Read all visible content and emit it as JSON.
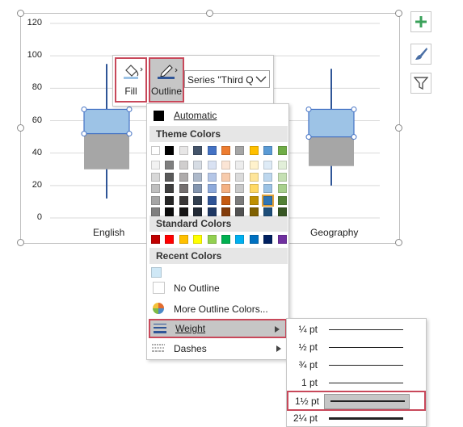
{
  "chart": {
    "y_axis_ticks": [
      "120",
      "100",
      "80",
      "60",
      "40",
      "20",
      "0"
    ],
    "x_axis_labels": {
      "first": "English",
      "last": "Geography"
    },
    "colors": {
      "q2_fill": "#a6a6a6",
      "q3_fill": "#9dc3e6",
      "whisker": "#2f5597",
      "selection": "#4472c4"
    }
  },
  "chart_data": {
    "type": "box",
    "categories": [
      "English",
      "Geography"
    ],
    "series": [
      {
        "min": 12,
        "q1": 30,
        "median": 52,
        "q3": 67,
        "max": 95
      },
      {
        "min": 20,
        "q1": 32,
        "median": 50,
        "q3": 67,
        "max": 92
      }
    ],
    "ylim": [
      0,
      120
    ]
  },
  "side_buttons": [
    {
      "icon": "plus-icon"
    },
    {
      "icon": "brush-icon"
    },
    {
      "icon": "filter-icon"
    }
  ],
  "toolbar": {
    "fill_label": "Fill",
    "outline_label": "Outline",
    "series_select": "Series \"Third Q"
  },
  "outline_menu": {
    "automatic": "Automatic",
    "theme_colors_header": "Theme Colors",
    "standard_colors_header": "Standard Colors",
    "recent_colors_header": "Recent Colors",
    "no_outline": "No Outline",
    "more_colors": "More Outline Colors...",
    "weight": "Weight",
    "dashes": "Dashes",
    "theme_base": [
      "#ffffff",
      "#000000",
      "#e7e6e6",
      "#44546a",
      "#4472c4",
      "#ed7d31",
      "#a5a5a5",
      "#ffc000",
      "#5b9bd5",
      "#70ad47"
    ],
    "theme_tints": [
      [
        "#f2f2f2",
        "#7f7f7f",
        "#d0cece",
        "#d6dce4",
        "#d9e2f3",
        "#fbe5d5",
        "#ededed",
        "#fff2cc",
        "#deebf6",
        "#e2efd9"
      ],
      [
        "#d8d8d8",
        "#595959",
        "#aeabab",
        "#adb9ca",
        "#b4c6e7",
        "#f7cbac",
        "#dbdbdb",
        "#fee599",
        "#bdd7ee",
        "#c5e0b3"
      ],
      [
        "#bfbfbf",
        "#3f3f3f",
        "#757070",
        "#8496b0",
        "#8eaadb",
        "#f4b183",
        "#c9c9c9",
        "#ffd965",
        "#9cc3e5",
        "#a8d08d"
      ],
      [
        "#a5a5a5",
        "#262626",
        "#3a3838",
        "#323f4f",
        "#2f5496",
        "#c55a11",
        "#7b7b7b",
        "#bf9000",
        "#2e75b5",
        "#538135"
      ],
      [
        "#7f7f7f",
        "#0c0c0c",
        "#171616",
        "#222a35",
        "#1f3864",
        "#833c0b",
        "#525252",
        "#7f6000",
        "#1e4e79",
        "#375623"
      ]
    ],
    "standard": [
      "#c00000",
      "#ff0000",
      "#ffc000",
      "#ffff00",
      "#92d050",
      "#00b050",
      "#00b0f0",
      "#0070c0",
      "#002060",
      "#7030a0"
    ],
    "recent": [
      "#cfe8f6"
    ]
  },
  "weight_menu": {
    "items": [
      {
        "label": "¼ pt",
        "thickness": 0.25
      },
      {
        "label": "½ pt",
        "thickness": 0.5
      },
      {
        "label": "¾ pt",
        "thickness": 0.75
      },
      {
        "label": "1 pt",
        "thickness": 1
      },
      {
        "label": "1½ pt",
        "thickness": 1.5
      },
      {
        "label": "2¼ pt",
        "thickness": 2.25
      }
    ],
    "selected_index": 4
  }
}
